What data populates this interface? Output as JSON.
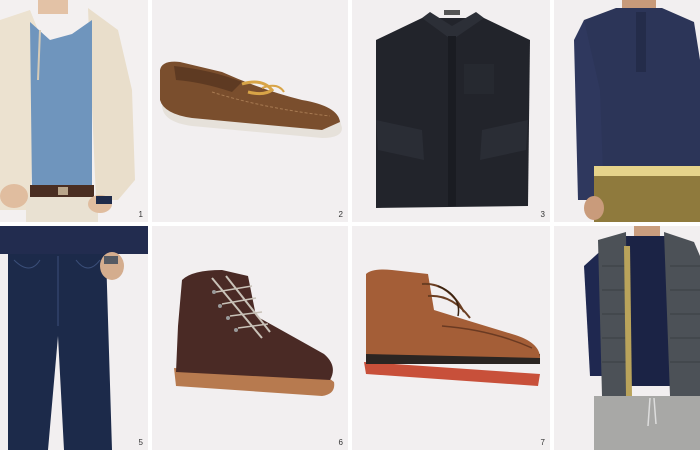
{
  "products": [
    {
      "name": "cream-zip-hoodie-look",
      "number": "1"
    },
    {
      "name": "brown-leather-boat-shoe",
      "number": "2"
    },
    {
      "name": "black-button-down-shirt",
      "number": "3"
    },
    {
      "name": "navy-henley-khaki-chinos",
      "number": ""
    },
    {
      "name": "dark-wash-jeans",
      "number": "5"
    },
    {
      "name": "brown-leather-work-boot",
      "number": "6"
    },
    {
      "name": "tan-leather-chukka-boot",
      "number": "7"
    },
    {
      "name": "gray-puffer-vest-look",
      "number": ""
    }
  ],
  "colors": {
    "background": "#ffffff",
    "tile": "#f2eff0",
    "denim": "#1c2a4a",
    "navy": "#2c3558",
    "leather_brown": "#7a4e2d",
    "dark_leather": "#4a2a25"
  }
}
